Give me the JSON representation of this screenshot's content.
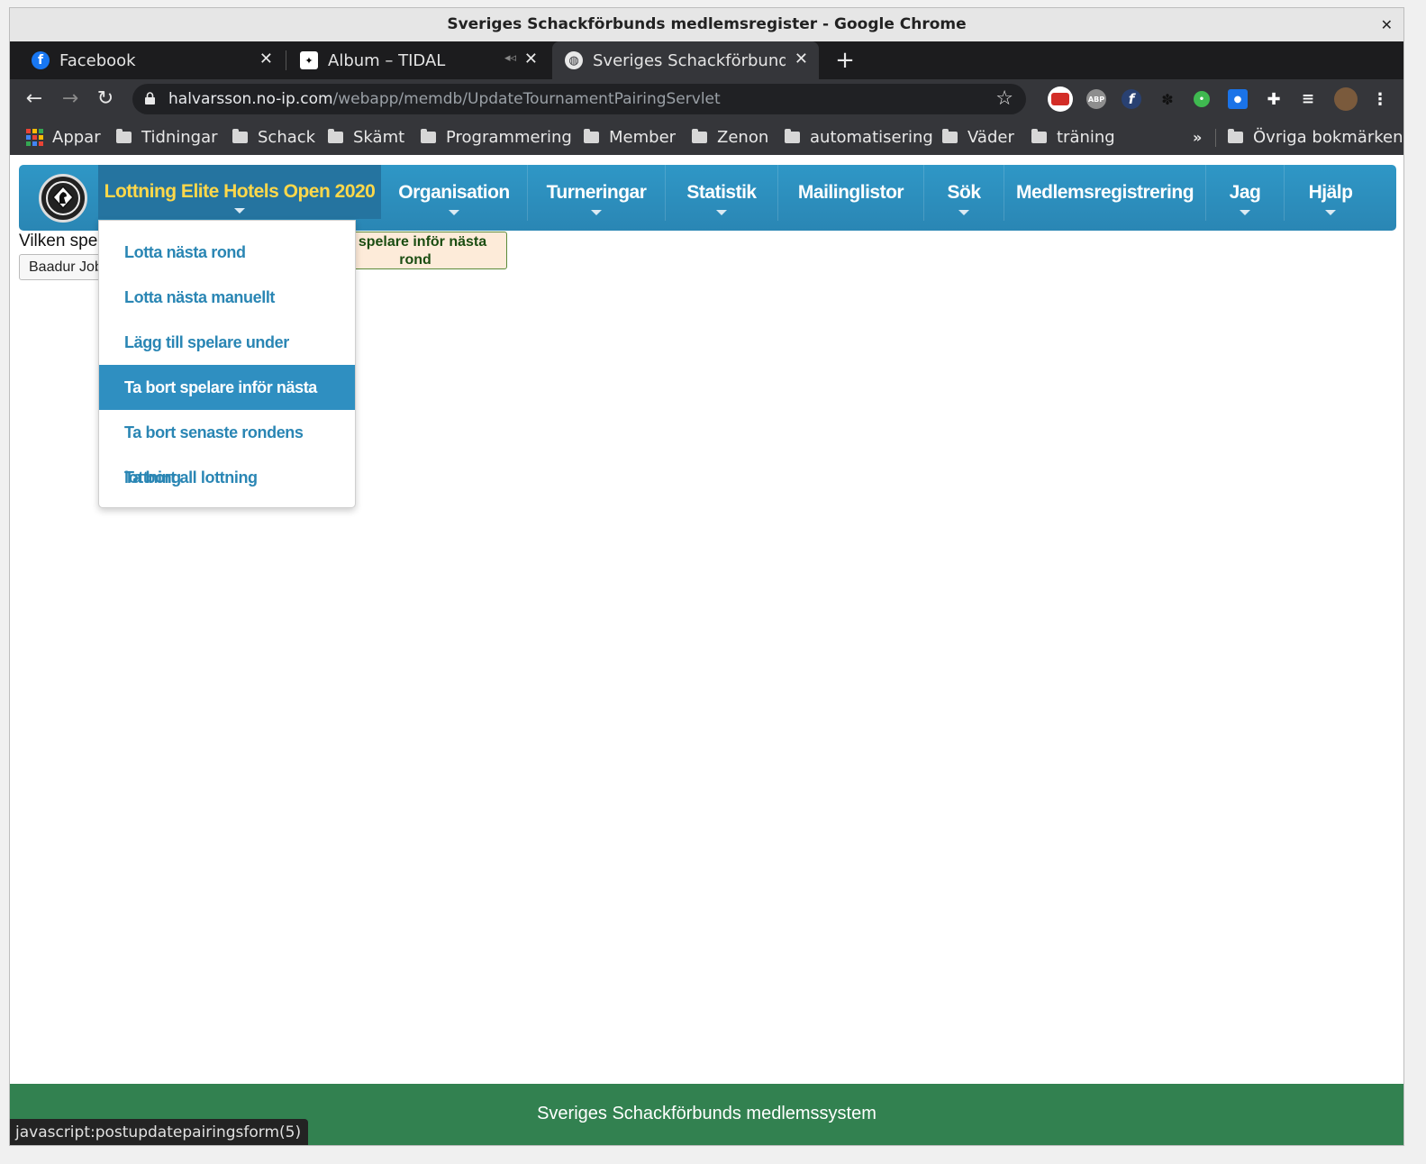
{
  "window_title": "Sveriges Schackförbunds medlemsregister - Google Chrome",
  "tabs": [
    {
      "label": "Facebook"
    },
    {
      "label": "Album – TIDAL"
    },
    {
      "label": "Sveriges Schackförbunds m"
    }
  ],
  "address": {
    "host": "halvarsson.no-ip.com",
    "path": "/webapp/memdb/UpdateTournamentPairingServlet"
  },
  "extensions": {
    "abp": "ABP"
  },
  "bookmarks": {
    "apps": "Appar",
    "folders": [
      "Tidningar",
      "Schack",
      "Skämt",
      "Programmering",
      "Member",
      "Zenon",
      "automatisering",
      "Väder",
      "träning"
    ],
    "more": "»",
    "other": "Övriga bokmärken"
  },
  "nav": {
    "items": [
      "Lottning Elite Hotels Open 2020",
      "Organisation",
      "Turneringar",
      "Statistik",
      "Mailinglistor",
      "Sök",
      "Medlemsregistrering",
      "Jag",
      "Hjälp"
    ]
  },
  "dropdown": {
    "items": [
      "Lotta nästa rond",
      "Lotta nästa manuellt",
      "Lägg till spelare under turnering",
      "Ta bort spelare inför nästa rond",
      "Ta bort senaste rondens lottning",
      "Ta bort all lottning"
    ]
  },
  "form": {
    "prompt": "Vilken spe",
    "selected_player": "Baadur Jobava",
    "button_label": "rt spelare inför nästa rond"
  },
  "footer": "Sveriges Schackförbunds medlemssystem",
  "status_url": "javascript:postupdatepairingsform(5)",
  "colors": {
    "nav_blue": "#2f97c6",
    "active_gold": "#ffd84a",
    "footer_green": "#328150"
  }
}
